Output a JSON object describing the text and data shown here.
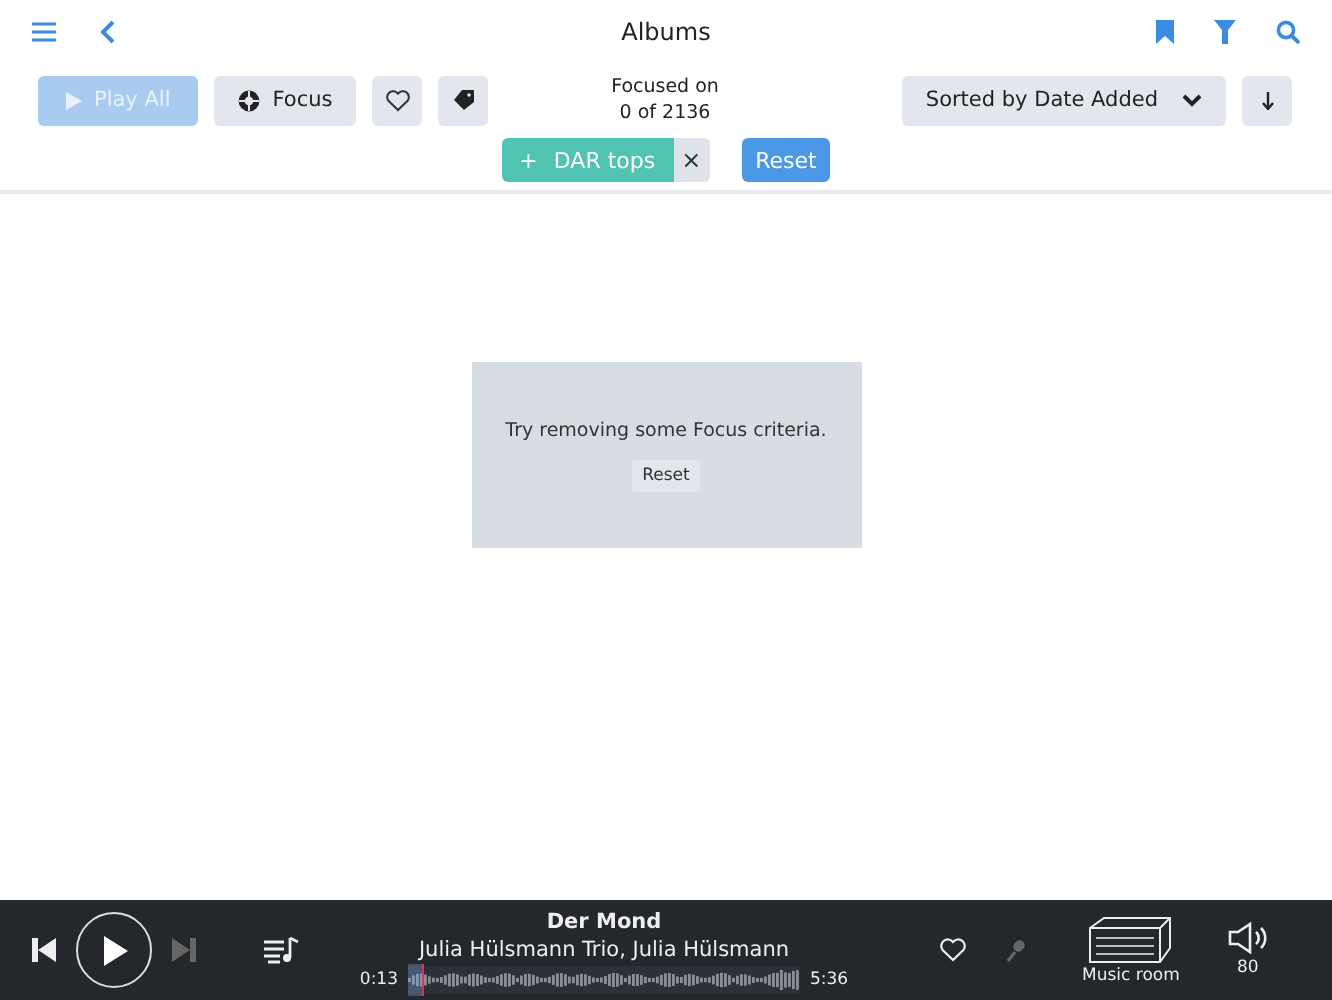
{
  "header": {
    "title": "Albums"
  },
  "toolbar": {
    "play_all": {
      "label": "Play All",
      "disabled": true
    },
    "focus": {
      "label": "Focus"
    },
    "focus_status": {
      "line_1": "Focused on",
      "line_2": "0 of 2136"
    },
    "sort": {
      "label": "Sorted by Date Added"
    }
  },
  "focus_chips": [
    {
      "label": "DAR tops",
      "symbol": "+",
      "remove": "×"
    }
  ],
  "reset_button": "Reset",
  "empty_state": {
    "message": "Try removing some Focus criteria.",
    "button": "Reset"
  },
  "player": {
    "title": "Der Mond",
    "artist": "Julia Hülsmann Trio, Julia Hülsmann",
    "elapsed": "0:13",
    "duration": "5:36",
    "level": 0.04,
    "zone": "Music room",
    "volume": "80"
  }
}
